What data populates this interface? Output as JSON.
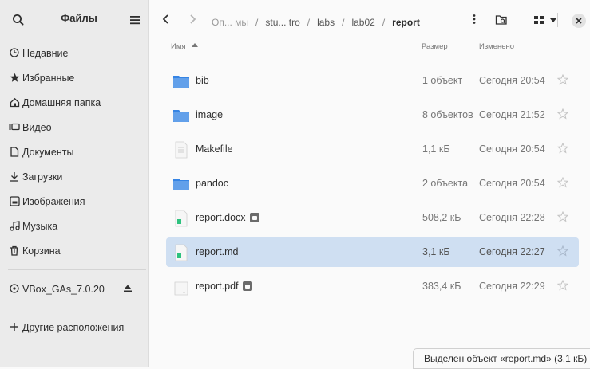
{
  "sidebar": {
    "title": "Файлы",
    "items": [
      {
        "label": "Недавние",
        "icon": "clock-icon"
      },
      {
        "label": "Избранные",
        "icon": "star-icon"
      },
      {
        "label": "Домашняя папка",
        "icon": "home-icon"
      },
      {
        "label": "Видео",
        "icon": "video-icon"
      },
      {
        "label": "Документы",
        "icon": "document-icon"
      },
      {
        "label": "Загрузки",
        "icon": "download-icon"
      },
      {
        "label": "Изображения",
        "icon": "image-icon"
      },
      {
        "label": "Музыка",
        "icon": "music-icon"
      },
      {
        "label": "Корзина",
        "icon": "trash-icon"
      }
    ],
    "device": {
      "label": "VBox_GAs_7.0.20",
      "icon": "disc-icon"
    },
    "other": {
      "label": "Другие расположения",
      "icon": "plus-icon"
    }
  },
  "pathbar": {
    "segments": [
      "Оп... мы",
      "stu... tro",
      "labs",
      "lab02"
    ],
    "current": "report"
  },
  "columns": {
    "name": "Имя",
    "size": "Размер",
    "modified": "Изменено"
  },
  "files": [
    {
      "name": "bib",
      "size": "1 объект",
      "modified": "Сегодня 20:54",
      "type": "folder",
      "locked": false
    },
    {
      "name": "image",
      "size": "8 объектов",
      "modified": "Сегодня 21:52",
      "type": "folder",
      "locked": false
    },
    {
      "name": "Makefile",
      "size": "1,1 кБ",
      "modified": "Сегодня 20:54",
      "type": "text",
      "locked": false
    },
    {
      "name": "pandoc",
      "size": "2 объекта",
      "modified": "Сегодня 20:54",
      "type": "folder",
      "locked": false
    },
    {
      "name": "report.docx",
      "size": "508,2 кБ",
      "modified": "Сегодня 22:28",
      "type": "doc",
      "locked": true
    },
    {
      "name": "report.md",
      "size": "3,1 кБ",
      "modified": "Сегодня 22:27",
      "type": "doc",
      "locked": false,
      "selected": true
    },
    {
      "name": "report.pdf",
      "size": "383,4 кБ",
      "modified": "Сегодня 22:29",
      "type": "pdf",
      "locked": true
    }
  ],
  "status": "Выделен объект «report.md» (3,1 кБ)",
  "colors": {
    "folder": "#62a0ea",
    "selection": "#cfdff2",
    "sidebar": "#ebebeb"
  }
}
